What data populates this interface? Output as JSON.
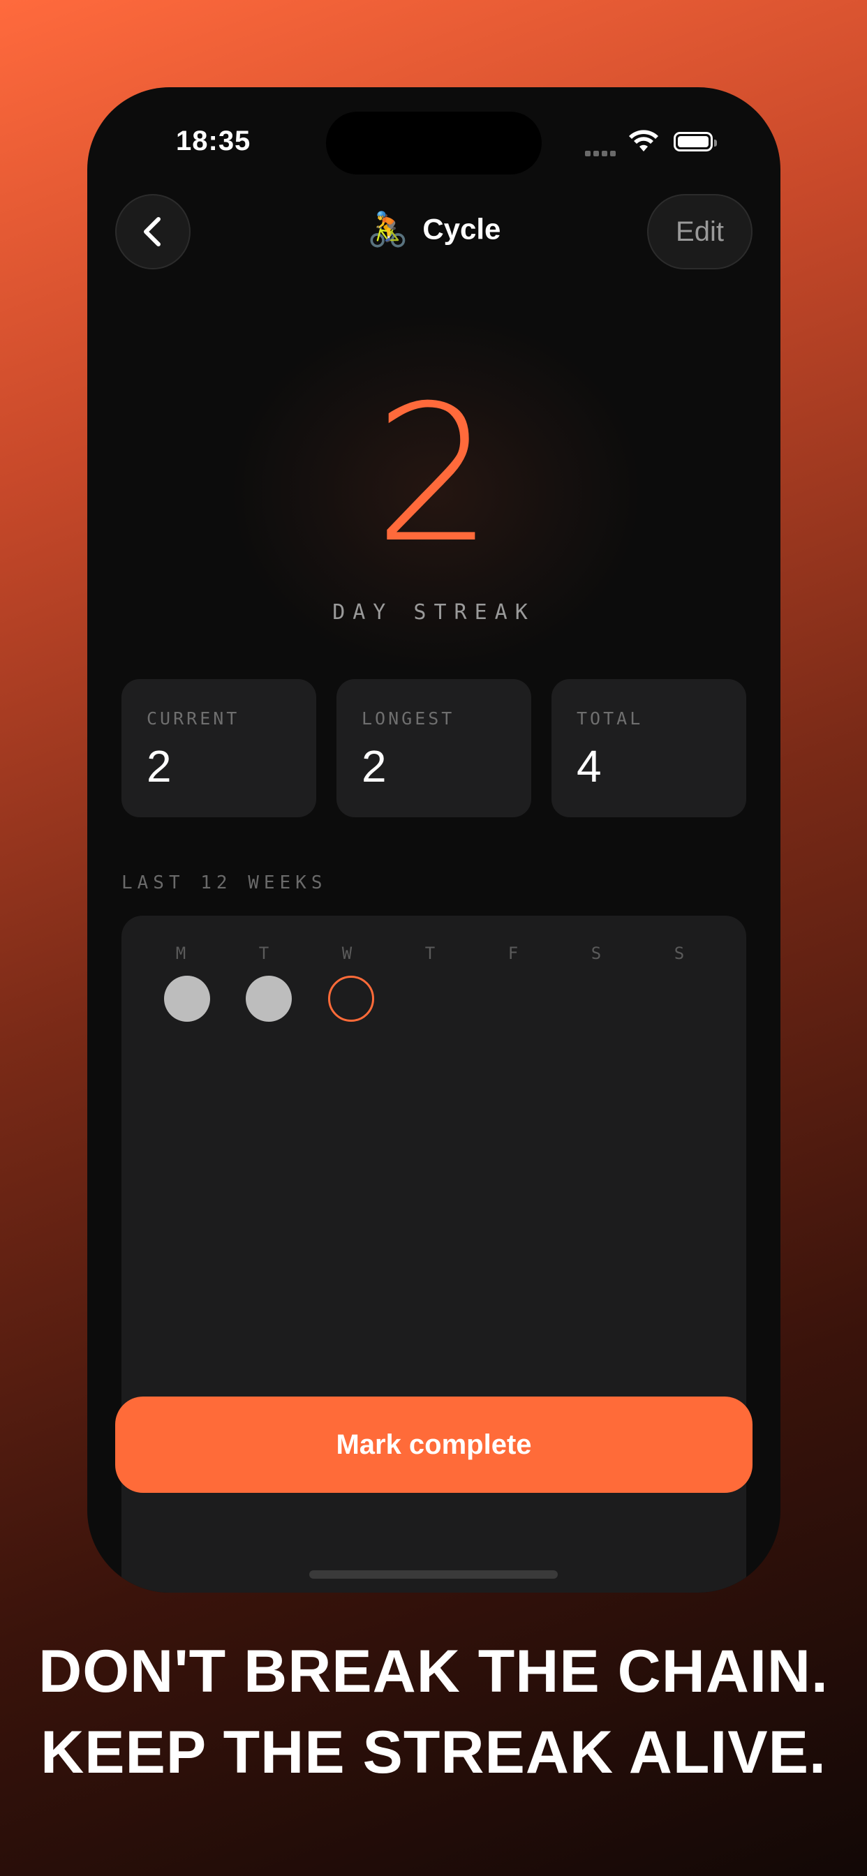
{
  "status_bar": {
    "time": "18:35"
  },
  "header": {
    "emoji": "🚴",
    "title": "Cycle",
    "edit_label": "Edit"
  },
  "streak": {
    "value": "2",
    "label": "DAY STREAK"
  },
  "stats": [
    {
      "label": "CURRENT",
      "value": "2"
    },
    {
      "label": "LONGEST",
      "value": "2"
    },
    {
      "label": "TOTAL",
      "value": "4"
    }
  ],
  "calendar": {
    "section_label": "LAST 12 WEEKS",
    "days": [
      "M",
      "T",
      "W",
      "T",
      "F",
      "S",
      "S"
    ],
    "first_week_states": [
      "done",
      "done",
      "today",
      "",
      "",
      "",
      ""
    ]
  },
  "action": {
    "mark_complete_label": "Mark complete"
  },
  "tagline": {
    "line1": "DON'T BREAK THE CHAIN.",
    "line2": "KEEP THE STREAK ALIVE."
  },
  "colors": {
    "accent": "#ff6b39",
    "done_dot": "#bdbdbd",
    "card_bg": "#1e1e1f"
  }
}
